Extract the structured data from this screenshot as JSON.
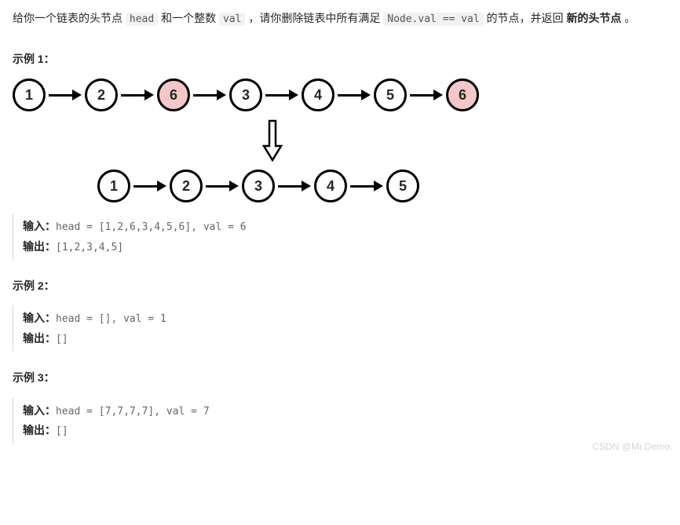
{
  "problem": {
    "prefix": "给你一个链表的头节点 ",
    "code1": "head",
    "mid1": " 和一个整数 ",
    "code2": "val",
    "mid2": " ，请你删除链表中所有满足 ",
    "code3": "Node.val == val",
    "mid3": " 的节点，并返回 ",
    "bold_tail": "新的头节点",
    "tail": " 。"
  },
  "examples": [
    {
      "title": "示例 1：",
      "input_label": "输入：",
      "input_text": "head = [1,2,6,3,4,5,6], val = 6",
      "output_label": "输出：",
      "output_text": "[1,2,3,4,5]"
    },
    {
      "title": "示例 2：",
      "input_label": "输入：",
      "input_text": "head = [], val = 1",
      "output_label": "输出：",
      "output_text": "[]"
    },
    {
      "title": "示例 3：",
      "input_label": "输入：",
      "input_text": "head = [7,7,7,7], val = 7",
      "output_label": "输出：",
      "output_text": "[]"
    }
  ],
  "chart_data": {
    "type": "table",
    "before_list": [
      "1",
      "2",
      "6",
      "3",
      "4",
      "5",
      "6"
    ],
    "highlight_value": "6",
    "after_list": [
      "1",
      "2",
      "3",
      "4",
      "5"
    ]
  },
  "watermark": "CSDN @Mr.Demo."
}
